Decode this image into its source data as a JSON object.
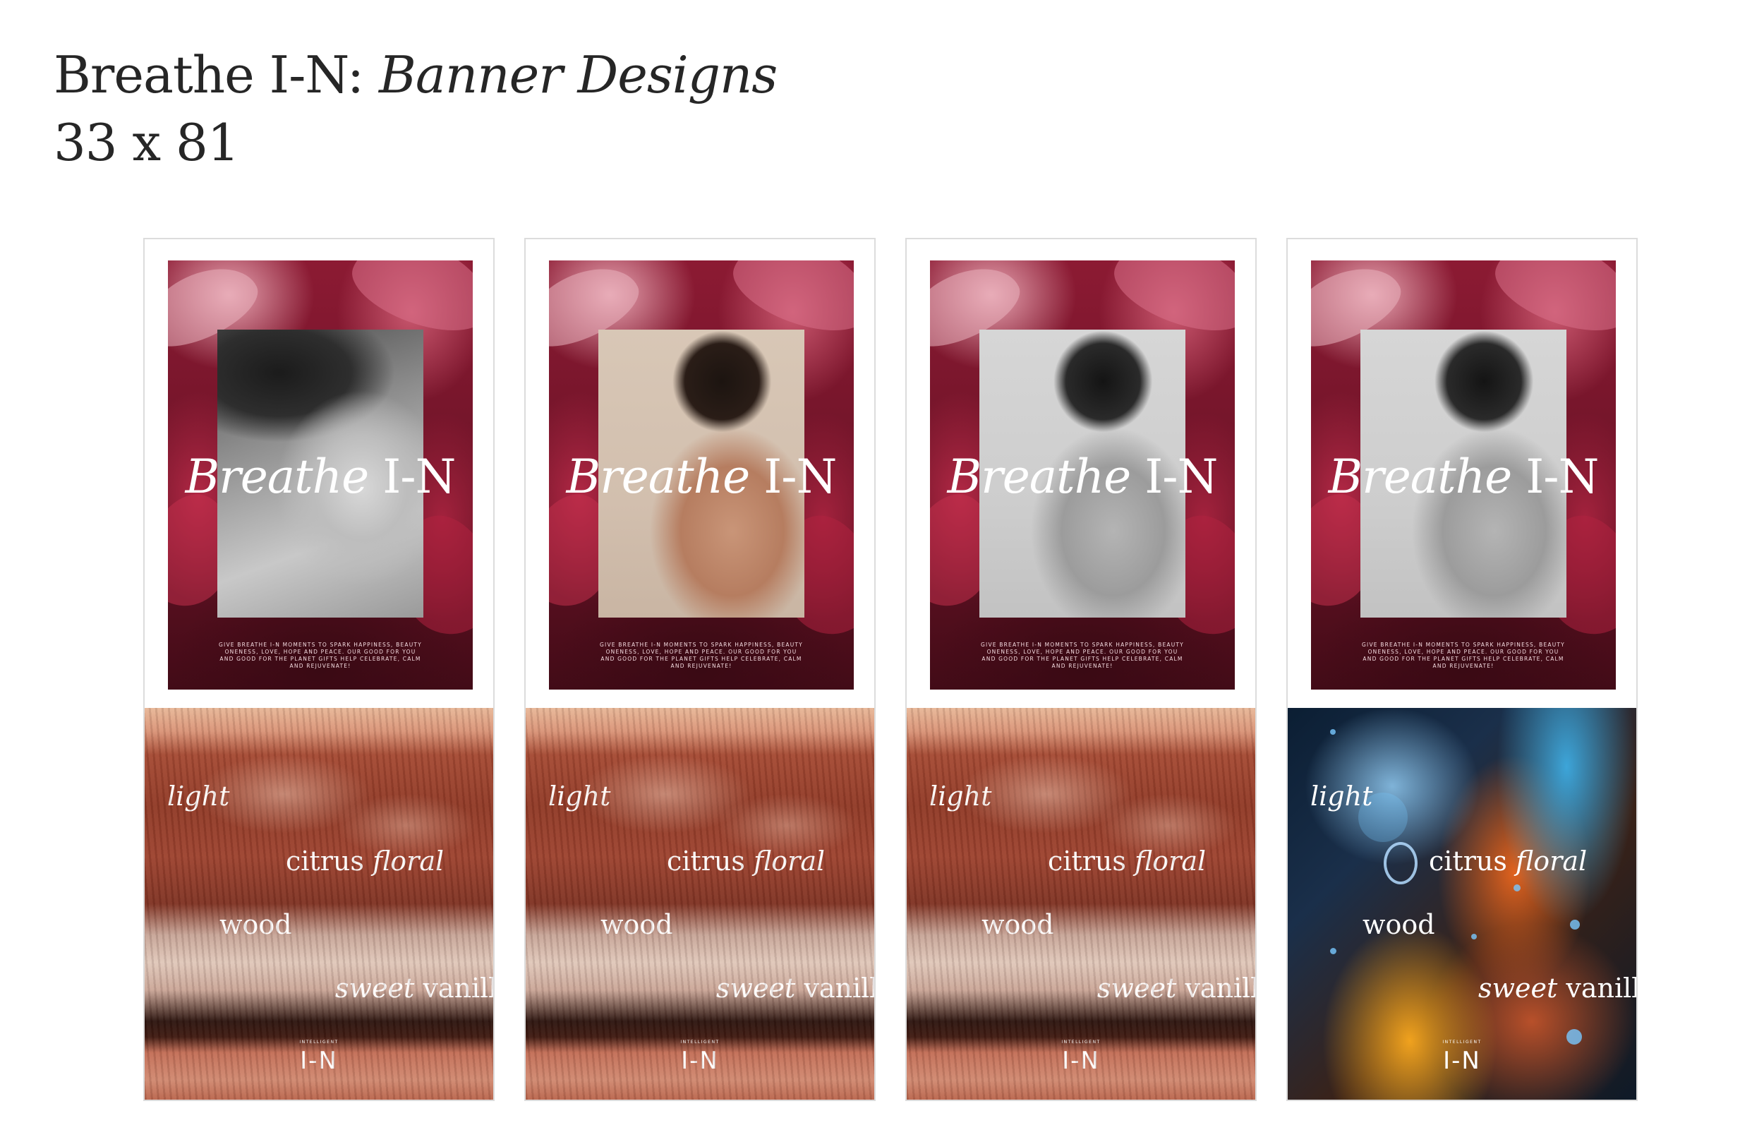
{
  "header": {
    "title_plain": "Breathe I-N: ",
    "title_italic": "Banner Designs",
    "subtitle": "33 x 81"
  },
  "banners": [
    {
      "variant": "face-bw",
      "poster_title_italic": "Breathe",
      "poster_title_plain": " I-N",
      "poster_copy": "GIVE BREATHE I-N MOMENTS TO SPARK HAPPINESS, BEAUTY ONENESS, LOVE, HOPE AND PEACE. OUR GOOD FOR YOU AND GOOD FOR THE PLANET GIFTS HELP CELEBRATE, CALM AND REJUVENATE!",
      "lower_style": "lips",
      "words": {
        "light": "light",
        "citrus": "citrus",
        "floral": "floral",
        "wood": "wood",
        "sweet": "sweet",
        "vanilla": "vanilla"
      },
      "logo_small": "INTELLIGENT",
      "logo_big": "I-N"
    },
    {
      "variant": "back-color",
      "poster_title_italic": "Breathe",
      "poster_title_plain": " I-N",
      "poster_copy": "GIVE BREATHE I-N MOMENTS TO SPARK HAPPINESS, BEAUTY ONENESS, LOVE, HOPE AND PEACE. OUR GOOD FOR YOU AND GOOD FOR THE PLANET GIFTS HELP CELEBRATE, CALM AND REJUVENATE!",
      "lower_style": "lips",
      "words": {
        "light": "light",
        "citrus": "citrus",
        "floral": "floral",
        "wood": "wood",
        "sweet": "sweet",
        "vanilla": "vanilla"
      },
      "logo_small": "INTELLIGENT",
      "logo_big": "I-N"
    },
    {
      "variant": "back-bw",
      "poster_title_italic": "Breathe",
      "poster_title_plain": " I-N",
      "poster_copy": "GIVE BREATHE I-N MOMENTS TO SPARK HAPPINESS, BEAUTY ONENESS, LOVE, HOPE AND PEACE. OUR GOOD FOR YOU AND GOOD FOR THE PLANET GIFTS HELP CELEBRATE, CALM AND REJUVENATE!",
      "lower_style": "lips",
      "words": {
        "light": "light",
        "citrus": "citrus",
        "floral": "floral",
        "wood": "wood",
        "sweet": "sweet",
        "vanilla": "vanilla"
      },
      "logo_small": "INTELLIGENT",
      "logo_big": "I-N"
    },
    {
      "variant": "back-bw",
      "poster_title_italic": "Breathe",
      "poster_title_plain": " I-N",
      "poster_copy": "GIVE BREATHE I-N MOMENTS TO SPARK HAPPINESS, BEAUTY ONENESS, LOVE, HOPE AND PEACE. OUR GOOD FOR YOU AND GOOD FOR THE PLANET GIFTS HELP CELEBRATE, CALM AND REJUVENATE!",
      "lower_style": "cosmic",
      "words": {
        "light": "light",
        "citrus": "citrus",
        "floral": "floral",
        "wood": "wood",
        "sweet": "sweet",
        "vanilla": "vanilla"
      },
      "logo_small": "INTELLIGENT",
      "logo_big": "I-N"
    }
  ],
  "colors": {
    "poster_crimson": "#8c1a33",
    "text_dark": "#262626"
  }
}
